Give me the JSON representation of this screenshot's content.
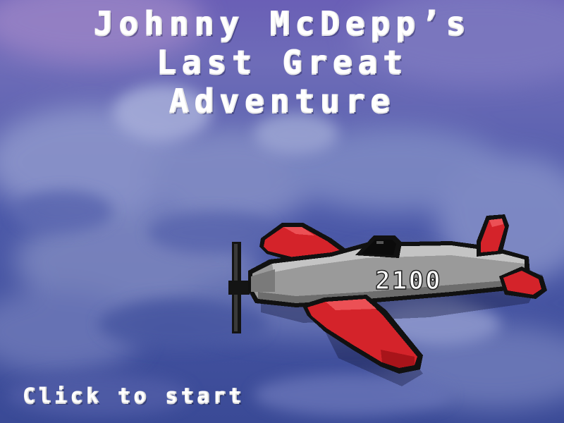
{
  "screen": {
    "name": "title-screen"
  },
  "title": {
    "lines": [
      "Johnny McDepp’s",
      "Last Great",
      "Adventure"
    ]
  },
  "start_prompt": "Click to start",
  "plane": {
    "number": "2100",
    "body_color": "#9a9a9a",
    "wing_color": "#d4232a",
    "outline_color": "#111111"
  },
  "background": {
    "sky_color": "#4a5ab0",
    "cloud_color": "#8c94c8",
    "highlight_color": "#9a7fc0"
  }
}
